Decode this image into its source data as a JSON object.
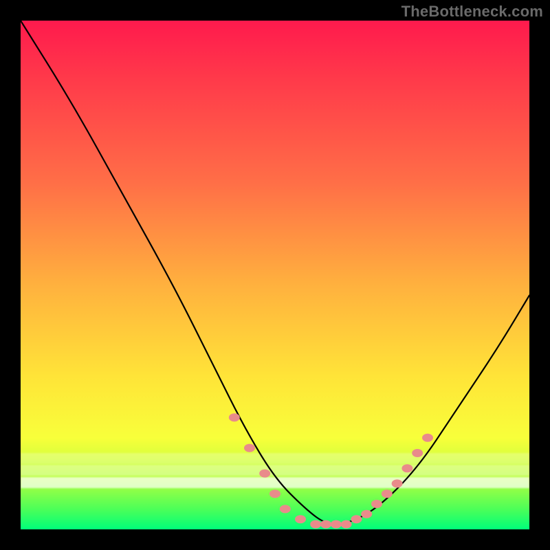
{
  "watermark": "TheBottleneck.com",
  "chart_data": {
    "type": "line",
    "title": "",
    "xlabel": "",
    "ylabel": "",
    "xlim": [
      0,
      100
    ],
    "ylim": [
      0,
      100
    ],
    "series": [
      {
        "name": "bottleneck-curve",
        "x": [
          0,
          10,
          20,
          30,
          38,
          44,
          50,
          56,
          60,
          64,
          70,
          78,
          86,
          94,
          100
        ],
        "y": [
          100,
          84,
          66,
          48,
          32,
          20,
          10,
          4,
          1,
          1,
          4,
          12,
          24,
          36,
          46
        ]
      }
    ],
    "markers": {
      "name": "fps-dots",
      "color": "#e98b8b",
      "x": [
        42,
        45,
        48,
        50,
        52,
        55,
        58,
        60,
        62,
        64,
        66,
        68,
        70,
        72,
        74,
        76,
        78,
        80
      ],
      "y": [
        22,
        16,
        11,
        7,
        4,
        2,
        1,
        1,
        1,
        1,
        2,
        3,
        5,
        7,
        9,
        12,
        15,
        18
      ]
    },
    "colors": {
      "curve": "#000000",
      "marker": "#e98b8b",
      "gradient_top": "#ff1a4d",
      "gradient_mid": "#ffe438",
      "gradient_bottom": "#00ff7a"
    }
  }
}
